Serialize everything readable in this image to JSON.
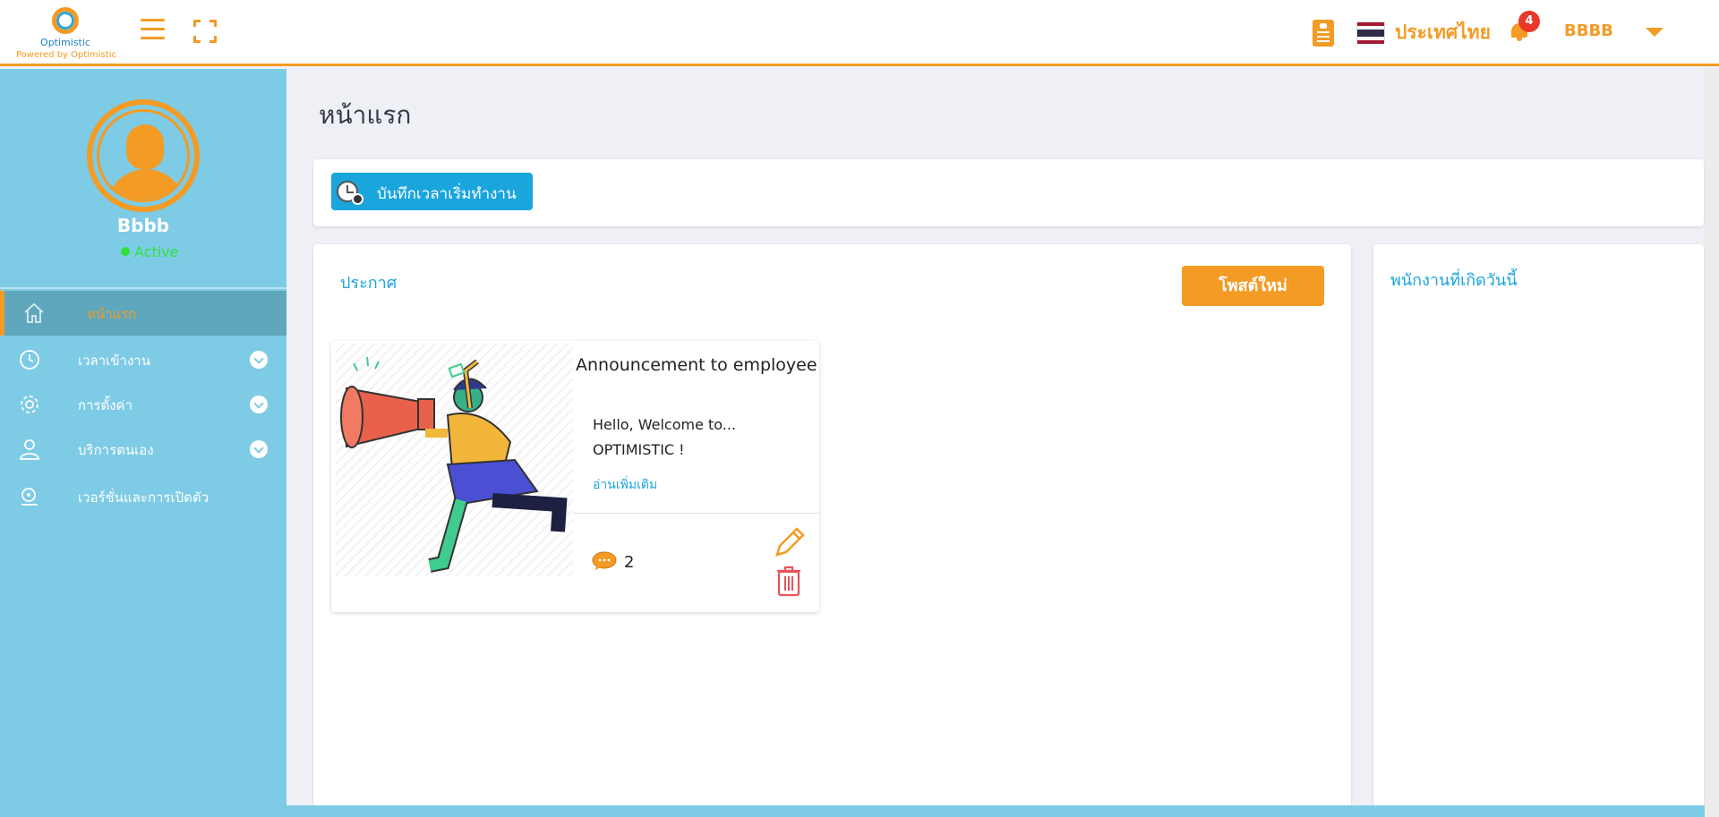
{
  "brand": {
    "name": "Optimistic",
    "tagline": "Powered by Optimistic",
    "accent_color": "#f39b24",
    "sidebar_color": "#7ecbe5",
    "link_color": "#1aa5dd"
  },
  "header": {
    "country": "ประเทศไทย",
    "notification_count": "4",
    "username": "BBBB",
    "icons": [
      "menu-icon",
      "fullscreen-icon",
      "document-checklist-icon",
      "thai-flag-icon",
      "bell-icon",
      "caret-down-icon"
    ]
  },
  "profile": {
    "name": "Bbbb",
    "status": "Active"
  },
  "sidebar": {
    "items": [
      {
        "label": "หน้าแรก",
        "icon": "home-icon",
        "active": true
      },
      {
        "label": "เวลาเข้างาน",
        "icon": "clock-icon",
        "expandable": true
      },
      {
        "label": "การตั้งค่า",
        "icon": "gear-icon",
        "expandable": true
      },
      {
        "label": "บริการตนเอง",
        "icon": "user-icon",
        "expandable": true
      },
      {
        "label": "เวอร์ชั่นและการเปิดตัว",
        "icon": "version-icon",
        "expandable": false
      }
    ]
  },
  "main": {
    "page_title": "หน้าแรก",
    "clock_in_label": "บันทึกเวลาเริ่มทำงาน",
    "announcements": {
      "title": "ประกาศ",
      "new_post_label": "โพสต์ใหม่",
      "posts": [
        {
          "title": "Announcement to employee",
          "body_line1": "Hello, Welcome to...",
          "body_line2": "OPTIMISTIC !",
          "read_more": "อ่านเพิ่มเติม",
          "comments": "2"
        }
      ]
    },
    "birthdays": {
      "title": "พนักงานที่เกิดวันนี้"
    }
  }
}
